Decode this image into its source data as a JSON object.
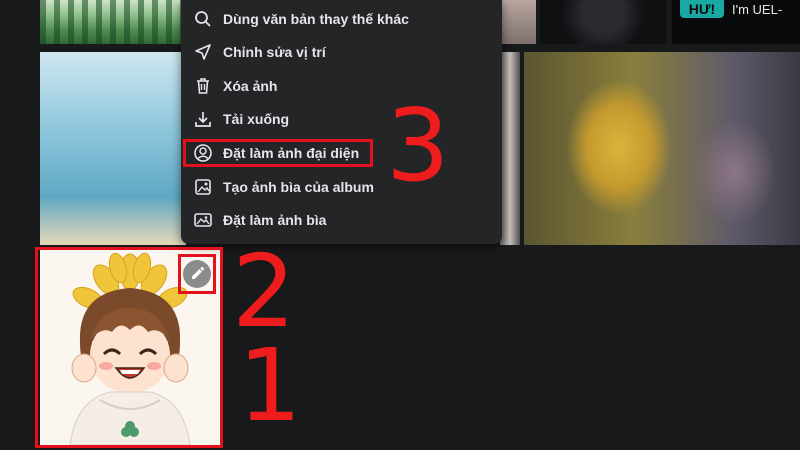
{
  "context_menu": {
    "items": [
      {
        "label": "Dùng văn bản thay thế khác",
        "icon": "search-icon"
      },
      {
        "label": "Chỉnh sửa vị trí",
        "icon": "location-arrow-icon"
      },
      {
        "label": "Xóa ảnh",
        "icon": "trash-icon"
      },
      {
        "label": "Tải xuống",
        "icon": "download-icon"
      },
      {
        "label": "Đặt làm ảnh đại diện",
        "icon": "profile-icon"
      },
      {
        "label": "Tạo ảnh bìa của album",
        "icon": "album-cover-icon"
      },
      {
        "label": "Đặt làm ảnh bìa",
        "icon": "image-icon"
      }
    ]
  },
  "photo_grid": {
    "top_right_tile": {
      "sign_text": "HƯ!",
      "caption": "I'm UEL-"
    }
  },
  "annotations": {
    "step1": "1",
    "step2": "2",
    "step3": "3",
    "color": "#e3101e"
  },
  "edit_button": {
    "icon": "pencil-icon"
  }
}
